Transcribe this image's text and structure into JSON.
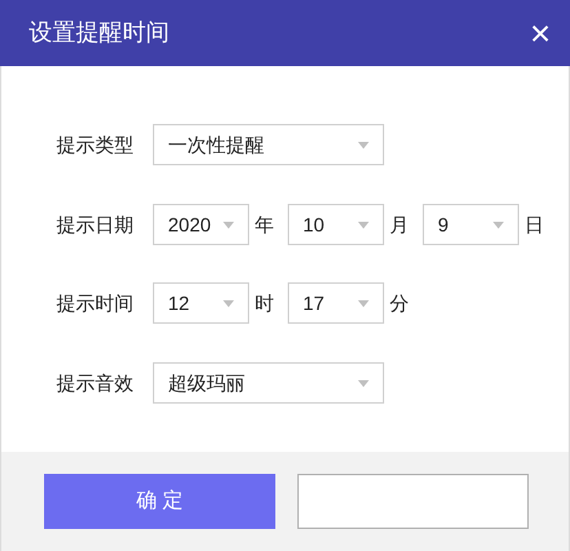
{
  "window": {
    "title": "设置提醒时间"
  },
  "close": "×",
  "rows": [
    {
      "label": "提示类型",
      "parts": [
        {
          "kind": "select",
          "value": "一次性提醒"
        }
      ]
    },
    {
      "label": "提示日期",
      "parts": [
        {
          "kind": "select",
          "value": "2020"
        },
        {
          "kind": "unit",
          "text": "年"
        },
        {
          "kind": "select",
          "value": "10"
        },
        {
          "kind": "unit",
          "text": "月"
        },
        {
          "kind": "select",
          "value": "9"
        },
        {
          "kind": "unit",
          "text": "日"
        }
      ]
    },
    {
      "label": "提示时间",
      "parts": [
        {
          "kind": "select",
          "value": "12"
        },
        {
          "kind": "unit",
          "text": "时"
        },
        {
          "kind": "select",
          "value": "17"
        },
        {
          "kind": "unit",
          "text": "分"
        }
      ]
    },
    {
      "label": "提示音效",
      "parts": [
        {
          "kind": "select",
          "value": "超级玛丽"
        }
      ]
    }
  ],
  "buttons": [
    {
      "label": "确 定",
      "kind": "primary"
    },
    {
      "kind": "secondary"
    }
  ]
}
